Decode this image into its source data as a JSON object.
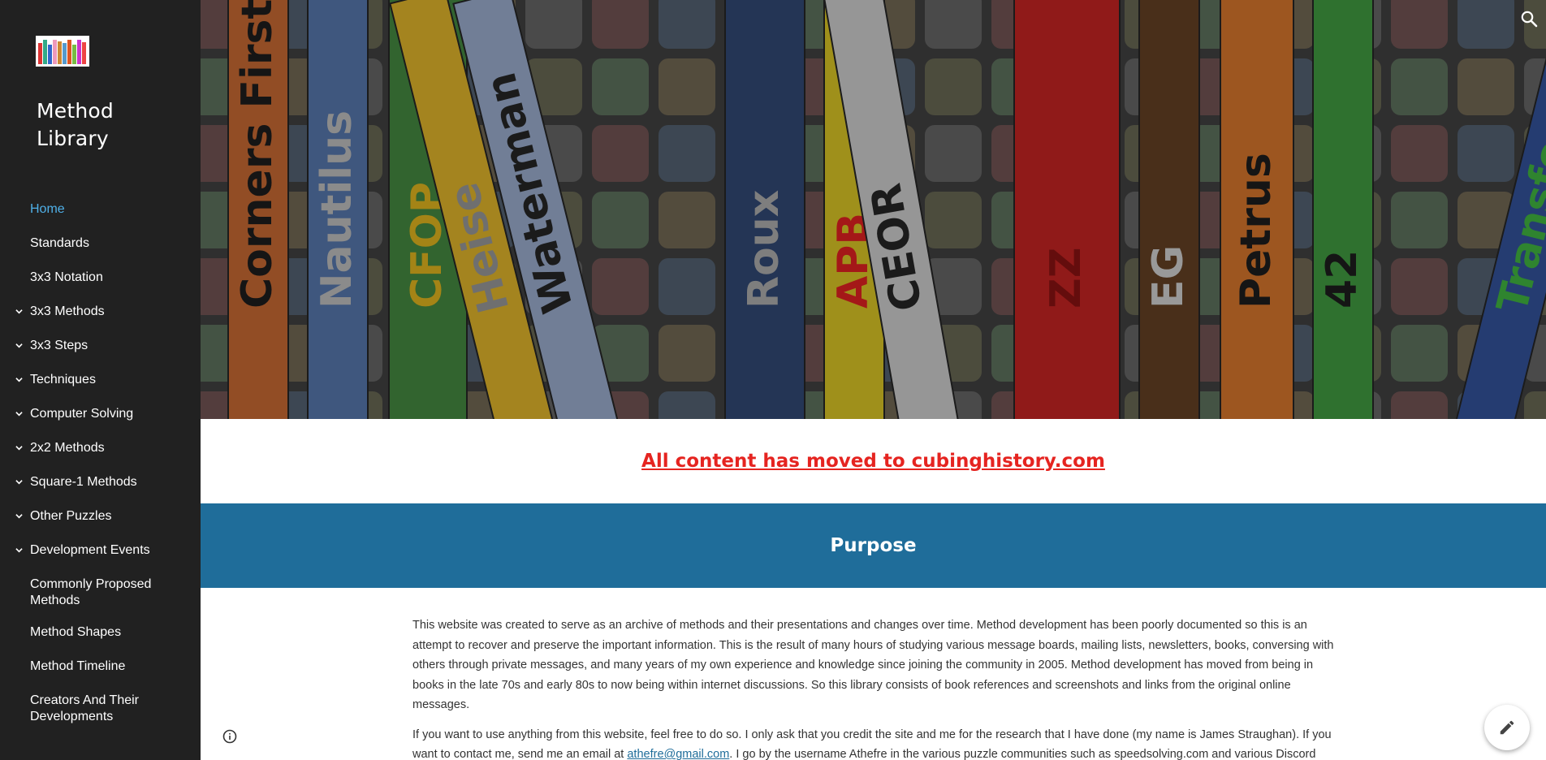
{
  "sidebar": {
    "logo_name": "bookshelf-logo",
    "site_title": "Method Library",
    "nav_items": [
      {
        "label": "Home",
        "active": true,
        "expandable": false
      },
      {
        "label": "Standards",
        "active": false,
        "expandable": false
      },
      {
        "label": "3x3 Notation",
        "active": false,
        "expandable": false
      },
      {
        "label": "3x3 Methods",
        "active": false,
        "expandable": true
      },
      {
        "label": "3x3 Steps",
        "active": false,
        "expandable": true
      },
      {
        "label": "Techniques",
        "active": false,
        "expandable": true
      },
      {
        "label": "Computer Solving",
        "active": false,
        "expandable": true
      },
      {
        "label": "2x2 Methods",
        "active": false,
        "expandable": true
      },
      {
        "label": "Square-1 Methods",
        "active": false,
        "expandable": true
      },
      {
        "label": "Other Puzzles",
        "active": false,
        "expandable": true
      },
      {
        "label": "Development Events",
        "active": false,
        "expandable": true
      },
      {
        "label": "Commonly Proposed Methods",
        "active": false,
        "expandable": false
      },
      {
        "label": "Method Shapes",
        "active": false,
        "expandable": false
      },
      {
        "label": "Method Timeline",
        "active": false,
        "expandable": false
      },
      {
        "label": "Creators And Their Developments",
        "active": false,
        "expandable": false
      }
    ]
  },
  "banner": {
    "books": [
      "Corners First",
      "Nautilus",
      "CFOP",
      "Heise",
      "Waterman",
      "Roux",
      "APB",
      "CEOR",
      "ZZ",
      "EG",
      "Petrus",
      "42",
      "Transformation"
    ]
  },
  "notice": {
    "text": "All content has moved to cubinghistory.com"
  },
  "purpose": {
    "heading": "Purpose"
  },
  "content": {
    "para1": "This website was created to serve as an archive of methods and their presentations and changes over time. Method development has been poorly documented so this is an attempt to recover and preserve the important information. This is the result of many hours of studying various message boards, mailing lists, newsletters, books, conversing with others through private messages, and many years of my own experience and knowledge since joining the community in 2005. Method development has moved from being in books in the late 70s and early 80s to now being within internet discussions. So this library consists of book references and screenshots and links from the original online messages.",
    "para2_before": "If you want to use anything from this website, feel free to do so. I only ask that you credit the site and me for the research that I have done (my name is James Straughan). If you want to contact me, send me an email at ",
    "email": "athefre@gmail.com",
    "para2_after": ". I go by the username Athefre in the various puzzle communities such as speedsolving.com and various Discord servers, so you can also contact me there. Some of the images may be more complicated, so please talk to me before using those."
  },
  "colors": {
    "sidebar_bg": "#212121",
    "active_nav": "#4fb0e8",
    "notice_red": "#e52420",
    "purpose_band": "#1f6d9a"
  },
  "icons": {
    "search": "search-icon",
    "edit": "pencil-icon",
    "info": "info-icon",
    "chevron": "chevron-down-icon"
  }
}
